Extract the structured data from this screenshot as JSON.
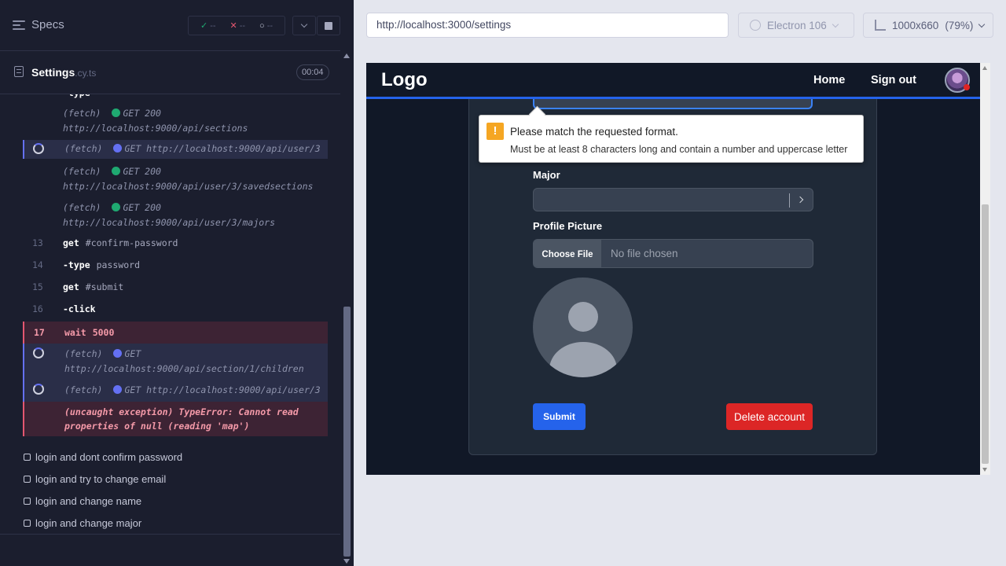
{
  "reporter": {
    "specs_label": "Specs",
    "stats": {
      "passed": "--",
      "failed": "--",
      "pending": "--"
    },
    "spec_file": {
      "name": "Settings",
      "ext": ".cy.ts"
    },
    "timer": "00:04",
    "commands": [
      {
        "kind": "xhr",
        "method": "(fetch)",
        "status_dot": "green",
        "text": "GET 200",
        "url": "http://localhost:9000/api/sections"
      },
      {
        "kind": "xhr-pending",
        "method": "(fetch)",
        "status_dot": "blue",
        "text": "GET http://localhost:9000/api/user/3"
      },
      {
        "kind": "xhr",
        "method": "(fetch)",
        "status_dot": "green",
        "text": "GET 200",
        "url": "http://localhost:9000/api/user/3/savedsections"
      },
      {
        "kind": "xhr",
        "method": "(fetch)",
        "status_dot": "green",
        "text": "GET 200",
        "url": "http://localhost:9000/api/user/3/majors"
      },
      {
        "kind": "cmd",
        "num": "13",
        "name": "get",
        "arg": "#confirm-password"
      },
      {
        "kind": "cmd",
        "num": "14",
        "name": "-type",
        "arg": "password"
      },
      {
        "kind": "cmd",
        "num": "15",
        "name": "get",
        "arg": "#submit"
      },
      {
        "kind": "cmd",
        "num": "16",
        "name": "-click",
        "arg": ""
      },
      {
        "kind": "cmd-active",
        "num": "17",
        "name": "wait",
        "arg": "5000"
      },
      {
        "kind": "xhr-pending",
        "method": "(fetch)",
        "status_dot": "blue",
        "text": "GET",
        "url": "http://localhost:9000/api/section/1/children"
      },
      {
        "kind": "xhr-pending",
        "method": "(fetch)",
        "status_dot": "blue",
        "text": "GET http://localhost:9000/api/user/3"
      },
      {
        "kind": "error",
        "line1": "(uncaught exception)  TypeError: Cannot read",
        "line2": "properties of null (reading 'map')"
      }
    ],
    "tests": [
      "login and dont confirm password",
      "login and try to change email",
      "login and change name",
      "login and change major"
    ]
  },
  "runner": {
    "url": "http://localhost:3000/settings",
    "browser": "Electron 106",
    "viewport": "1000x660",
    "zoom": "(79%)"
  },
  "app": {
    "logo": "Logo",
    "nav": {
      "home": "Home",
      "signout": "Sign out"
    },
    "tooltip": {
      "title": "Please match the requested format.",
      "message": "Must be at least 8 characters long and contain a number and uppercase letter"
    },
    "major_label": "Major",
    "pfp_label": "Profile Picture",
    "file_button": "Choose File",
    "file_status": "No file chosen",
    "submit": "Submit",
    "delete": "Delete account"
  },
  "colors": {
    "reporter_bg": "#1b1e2e",
    "pass": "#1fa971",
    "fail": "#e45770",
    "pending": "#6470f3",
    "primary": "#2563eb",
    "danger": "#dc2626"
  }
}
